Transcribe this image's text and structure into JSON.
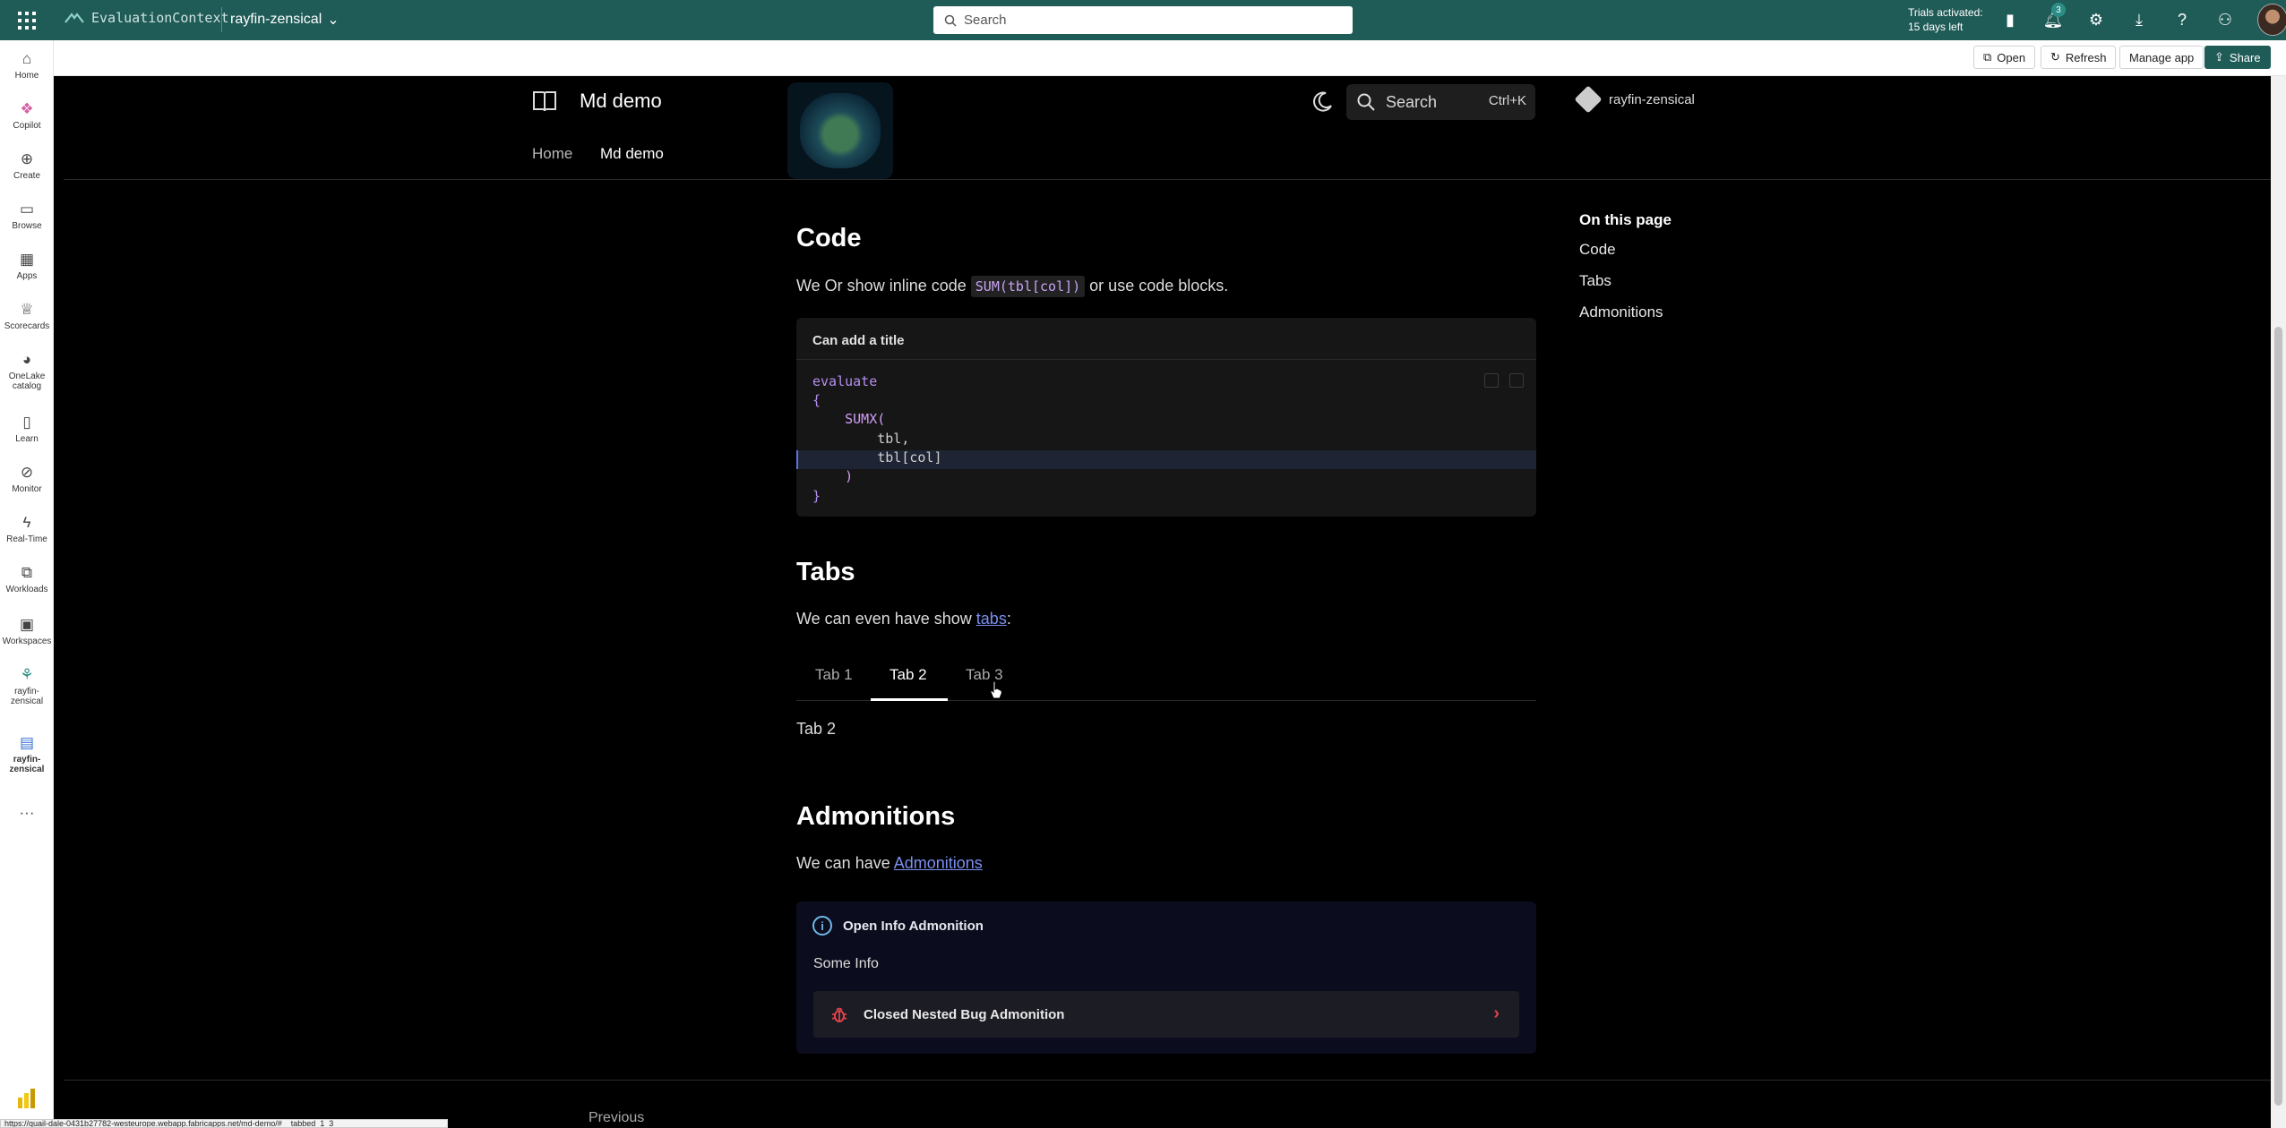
{
  "topbar": {
    "brand": "EvaluationContext",
    "workspace": "rayfin-zensical",
    "search_placeholder": "Search",
    "trial_line1": "Trials activated:",
    "trial_line2": "15 days left",
    "notif_count": "3",
    "accent": "#1f5b57"
  },
  "rail": [
    {
      "label": "Home",
      "icon": "home-icon"
    },
    {
      "label": "Copilot",
      "icon": "copilot-icon"
    },
    {
      "label": "Create",
      "icon": "plus-icon"
    },
    {
      "label": "Browse",
      "icon": "folder-icon"
    },
    {
      "label": "Apps",
      "icon": "apps-icon"
    },
    {
      "label": "Scorecards",
      "icon": "trophy-icon"
    },
    {
      "label": "OneLake catalog",
      "icon": "onelake-icon"
    },
    {
      "label": "Learn",
      "icon": "book-icon"
    },
    {
      "label": "Monitor",
      "icon": "monitor-icon"
    },
    {
      "label": "Real-Time",
      "icon": "lightning-icon"
    },
    {
      "label": "Workloads",
      "icon": "workloads-icon"
    },
    {
      "label": "Workspaces",
      "icon": "workspaces-icon"
    },
    {
      "label": "rayfin-zensical",
      "icon": "workspace-icon"
    },
    {
      "label": "rayfin-zensical",
      "icon": "app-icon"
    }
  ],
  "subbar": {
    "open": "Open",
    "refresh": "Refresh",
    "manage": "Manage app",
    "share": "Share"
  },
  "site": {
    "title": "Md demo",
    "nav_home": "Home",
    "nav_current": "Md demo",
    "search": "Search",
    "shortcut": "Ctrl+K",
    "repo": "rayfin-zensical"
  },
  "code_section": {
    "heading": "Code",
    "text_before": "We Or show inline code ",
    "inline_code": "SUM(tbl[col])",
    "text_after": " or use code blocks.",
    "block_title": "Can add a title",
    "lines": [
      "evaluate",
      "{",
      "    SUMX(",
      "        tbl,",
      "        tbl[col]",
      "    )",
      "}"
    ]
  },
  "tabs_section": {
    "heading": "Tabs",
    "text_before": "We can even have show ",
    "link": "tabs",
    "text_after": ":",
    "tabs": [
      "Tab 1",
      "Tab 2",
      "Tab 3"
    ],
    "active_tab": "Tab 2",
    "panel_text": "Tab 2"
  },
  "admon_section": {
    "heading": "Admonitions",
    "text_before": "We can have ",
    "link": "Admonitions",
    "info_title": "Open Info Admonition",
    "info_body": "Some Info",
    "nested_title": "Closed Nested Bug Admonition"
  },
  "toc": {
    "title": "On this page",
    "items": [
      "Code",
      "Tabs",
      "Admonitions"
    ]
  },
  "footer": {
    "previous": "Previous",
    "status_url": "https://quail-dale-0431b27782-westeurope.webapp.fabricapps.net/md-demo/#__tabbed_1_3"
  }
}
